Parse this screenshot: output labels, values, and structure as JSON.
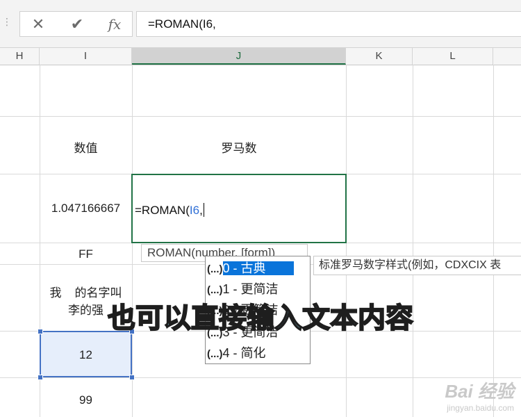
{
  "formula_bar": {
    "cancel_icon": "✕",
    "enter_icon": "✔",
    "fx_label": "fx",
    "formula": "=ROMAN(I6,"
  },
  "columns": [
    "H",
    "I",
    "J",
    "K",
    "L"
  ],
  "active_column": "J",
  "cells": {
    "I_header": "数值",
    "J_header": "罗马数",
    "I_value1": "1.047166667",
    "I_value2": "FF",
    "I_value3_line1": "我    的名字叫",
    "I_value3_line2": "李的强",
    "I_value4": "12",
    "I_value5": "99"
  },
  "active_cell": {
    "prefix": "=ROMAN(",
    "ref": "I6",
    "suffix": ","
  },
  "tooltip": {
    "text": "ROMAN(number, [form])"
  },
  "dropdown": {
    "items": [
      {
        "icon": "(...)",
        "label": "0 - 古典"
      },
      {
        "icon": "(...)",
        "label": "1 - 更简洁"
      },
      {
        "icon": "(...)",
        "label": "2 - 更简洁"
      },
      {
        "icon": "(...)",
        "label": "3 - 更简洁"
      },
      {
        "icon": "(...)",
        "label": "4 - 简化"
      }
    ]
  },
  "description": "标准罗马数字样式(例如，CDXCIX 表",
  "caption": "也可以直接输入文本内容",
  "watermark": {
    "brand": "Bai 经验",
    "url": "jingyan.baidu.com"
  },
  "colors": {
    "accent_green": "#217346",
    "selection_blue": "#0a74da",
    "caption_fill": "#8fd8f0"
  }
}
